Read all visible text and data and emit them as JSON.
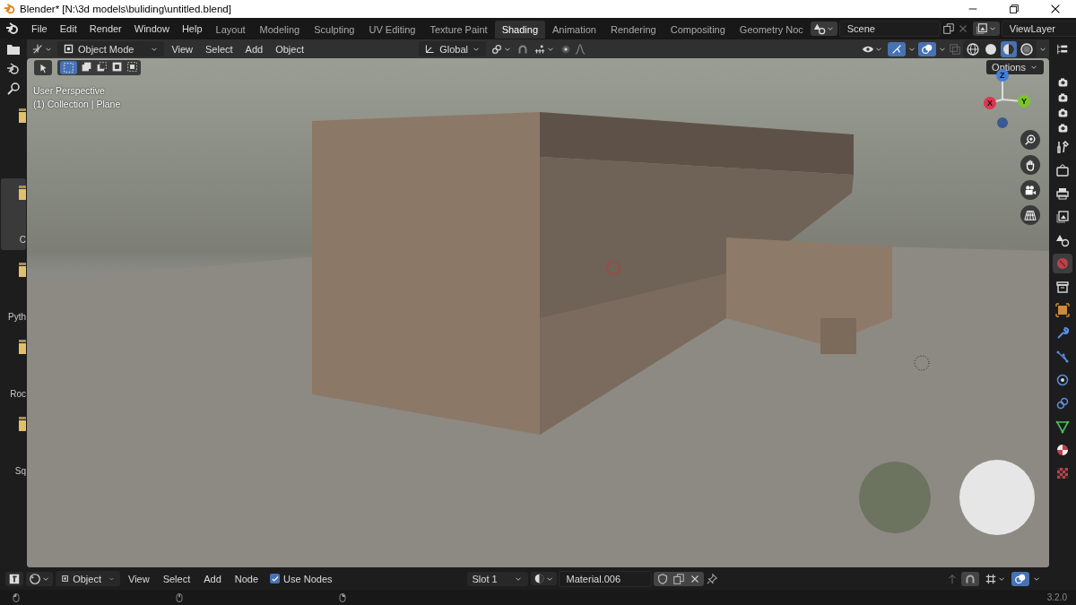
{
  "window": {
    "title": "Blender* [N:\\3d models\\buliding\\untitled.blend]"
  },
  "menu": [
    "File",
    "Edit",
    "Render",
    "Window",
    "Help"
  ],
  "workspaces": [
    {
      "label": "Layout",
      "selected": false
    },
    {
      "label": "Modeling",
      "selected": false
    },
    {
      "label": "Sculpting",
      "selected": false
    },
    {
      "label": "UV Editing",
      "selected": false
    },
    {
      "label": "Texture Paint",
      "selected": false
    },
    {
      "label": "Shading",
      "selected": true
    },
    {
      "label": "Animation",
      "selected": false
    },
    {
      "label": "Rendering",
      "selected": false
    },
    {
      "label": "Compositing",
      "selected": false
    },
    {
      "label": "Geometry Noc",
      "selected": false
    }
  ],
  "scene": {
    "value": "Scene"
  },
  "view_layer": {
    "value": "ViewLayer"
  },
  "viewport_header": {
    "mode": "Object Mode",
    "menus": [
      "View",
      "Select",
      "Add",
      "Object"
    ],
    "orientation": "Global",
    "gizmo_on": true,
    "overlay_on": true,
    "shading_modes": [
      {
        "kind": "wireframe",
        "selected": false
      },
      {
        "kind": "solid",
        "selected": false
      },
      {
        "kind": "material",
        "selected": true
      },
      {
        "kind": "rendered",
        "selected": false
      }
    ]
  },
  "file_browser": {
    "items": [
      {
        "selected": false
      },
      {
        "label": "C",
        "selected": true
      },
      {
        "label": "Pyth",
        "selected": false
      },
      {
        "label": "Roc",
        "selected": false
      },
      {
        "label": "Sq",
        "selected": false
      }
    ]
  },
  "viewport": {
    "view_name": "User Perspective",
    "object_info": "(1) Collection | Plane",
    "options": "Options",
    "axes": [
      "Z",
      "X",
      "Y"
    ]
  },
  "properties_tabs": [
    {
      "kind": "tool",
      "selected": false
    },
    {
      "kind": "render",
      "selected": false
    },
    {
      "kind": "output",
      "selected": false
    },
    {
      "kind": "view-layer",
      "selected": false
    },
    {
      "kind": "scene",
      "selected": false
    },
    {
      "kind": "world",
      "selected": true
    },
    {
      "kind": "collection",
      "selected": false
    },
    {
      "kind": "object",
      "selected": false
    },
    {
      "kind": "modifiers",
      "selected": false
    },
    {
      "kind": "particles",
      "selected": false
    },
    {
      "kind": "physics",
      "selected": false
    },
    {
      "kind": "constraints",
      "selected": false
    },
    {
      "kind": "data",
      "selected": false
    },
    {
      "kind": "material",
      "selected": false
    },
    {
      "kind": "texture",
      "selected": false
    }
  ],
  "node_header": {
    "editor": "Object",
    "menus": [
      "View",
      "Select",
      "Add",
      "Node"
    ],
    "use_nodes": {
      "label": "Use Nodes",
      "checked": true
    },
    "slot": "Slot 1",
    "material": "Material.006"
  },
  "status_bar": {
    "version": "3.2.0"
  }
}
